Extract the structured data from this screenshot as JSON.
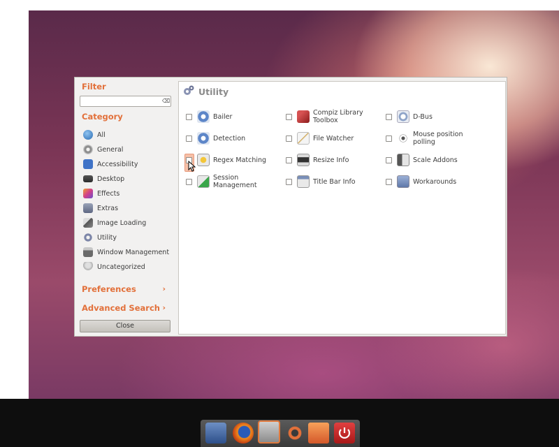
{
  "sidebar": {
    "filter_label": "Filter",
    "filter_placeholder": "",
    "category_label": "Category",
    "categories": [
      {
        "label": "All",
        "icon": "globe-icon"
      },
      {
        "label": "General",
        "icon": "gear-icon"
      },
      {
        "label": "Accessibility",
        "icon": "accessibility-icon"
      },
      {
        "label": "Desktop",
        "icon": "desktop-icon"
      },
      {
        "label": "Effects",
        "icon": "effects-icon"
      },
      {
        "label": "Extras",
        "icon": "extras-icon"
      },
      {
        "label": "Image Loading",
        "icon": "image-loading-icon"
      },
      {
        "label": "Utility",
        "icon": "utility-icon"
      },
      {
        "label": "Window Management",
        "icon": "window-management-icon"
      },
      {
        "label": "Uncategorized",
        "icon": "uncategorized-icon"
      }
    ],
    "preferences_label": "Preferences",
    "advanced_search_label": "Advanced Search",
    "close_label": "Close"
  },
  "content": {
    "title": "Utility",
    "plugins": [
      {
        "label": "Bailer",
        "icon": "bailer-icon"
      },
      {
        "label": "Compiz Library Toolbox",
        "icon": "compiz-library-toolbox-icon"
      },
      {
        "label": "D-Bus",
        "icon": "dbus-icon"
      },
      {
        "label": "Detection",
        "icon": "detection-icon"
      },
      {
        "label": "File Watcher",
        "icon": "file-watcher-icon"
      },
      {
        "label": "Mouse position polling",
        "icon": "mouse-position-icon"
      },
      {
        "label": "Regex Matching",
        "icon": "regex-matching-icon"
      },
      {
        "label": "Resize Info",
        "icon": "resize-info-icon"
      },
      {
        "label": "Scale Addons",
        "icon": "scale-addons-icon"
      },
      {
        "label": "Session Management",
        "icon": "session-management-icon"
      },
      {
        "label": "Title Bar Info",
        "icon": "title-bar-info-icon"
      },
      {
        "label": "Workarounds",
        "icon": "workarounds-icon"
      }
    ]
  },
  "dock": {
    "items": [
      "save-icon",
      "firefox-icon",
      "settings-manager-icon",
      "ubuntu-icon",
      "files-icon",
      "power-icon"
    ]
  },
  "colors": {
    "accent": "#e2703a",
    "hover_checkbox": "#f6c0a8"
  }
}
